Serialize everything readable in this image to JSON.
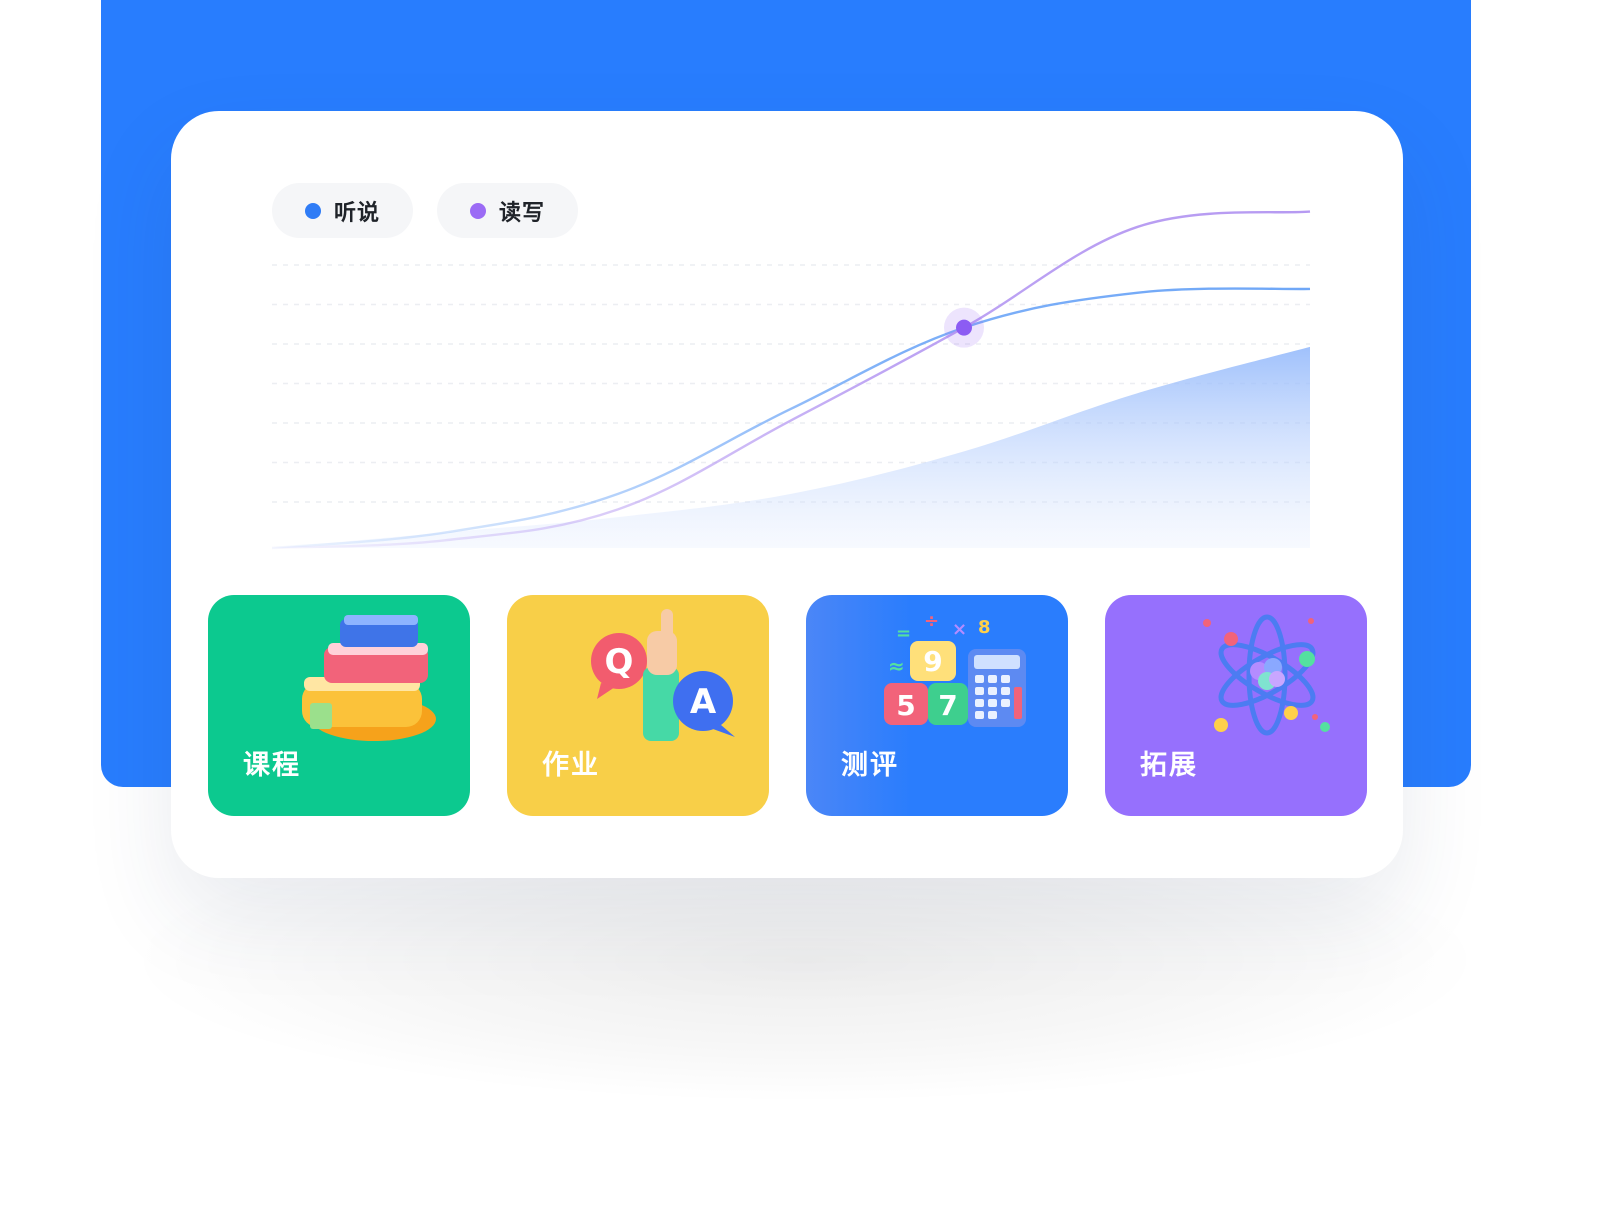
{
  "legend": {
    "items": [
      {
        "label": "听说",
        "color": "#2f7cf6"
      },
      {
        "label": "读写",
        "color": "#9b6bf5"
      }
    ]
  },
  "chart_data": {
    "type": "line",
    "title": "",
    "xlabel": "",
    "ylabel": "",
    "grid": true,
    "legend_position": "top-left",
    "x": [
      0,
      1,
      2,
      3,
      4,
      5,
      6
    ],
    "series": [
      {
        "name": "听说",
        "color": "#6fa7f7",
        "values": [
          0,
          4,
          14,
          36,
          57,
          66,
          67
        ]
      },
      {
        "name": "读写",
        "color": "#b69af2",
        "values": [
          0,
          2,
          10,
          33,
          57,
          83,
          87
        ]
      },
      {
        "name": "",
        "color": "#9ec0fb",
        "values": [
          0,
          4,
          8,
          14,
          25,
          40,
          52
        ]
      }
    ],
    "highlight_point": {
      "x": 4,
      "y": 57
    }
  },
  "tiles": [
    {
      "label": "课程",
      "color": "#0cc98f",
      "icon": "books-icon"
    },
    {
      "label": "作业",
      "color": "#f8cf48",
      "icon": "qa-hand-icon"
    },
    {
      "label": "测评",
      "color": "#2a7dfd",
      "icon": "calculator-blocks-icon"
    },
    {
      "label": "拓展",
      "color": "#9670fd",
      "icon": "atom-icon"
    }
  ]
}
